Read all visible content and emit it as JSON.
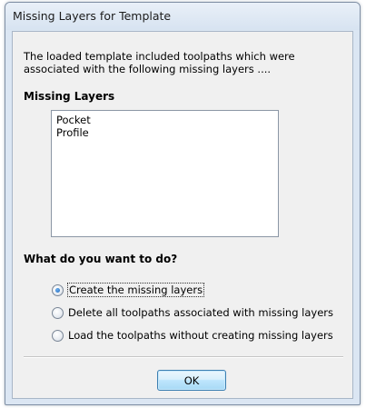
{
  "dialog": {
    "title": "Missing Layers for Template",
    "intro": "The loaded template included toolpaths which were associated with the following missing layers ....",
    "missing_layers_label": "Missing Layers",
    "missing_layers": [
      "Pocket",
      "Profile"
    ],
    "question_label": "What do you want to do?",
    "options": [
      {
        "label": "Create the missing layers",
        "selected": true
      },
      {
        "label": "Delete all toolpaths associated with missing layers",
        "selected": false
      },
      {
        "label": "Load the toolpaths without creating missing layers",
        "selected": false
      }
    ],
    "ok_label": "OK"
  }
}
